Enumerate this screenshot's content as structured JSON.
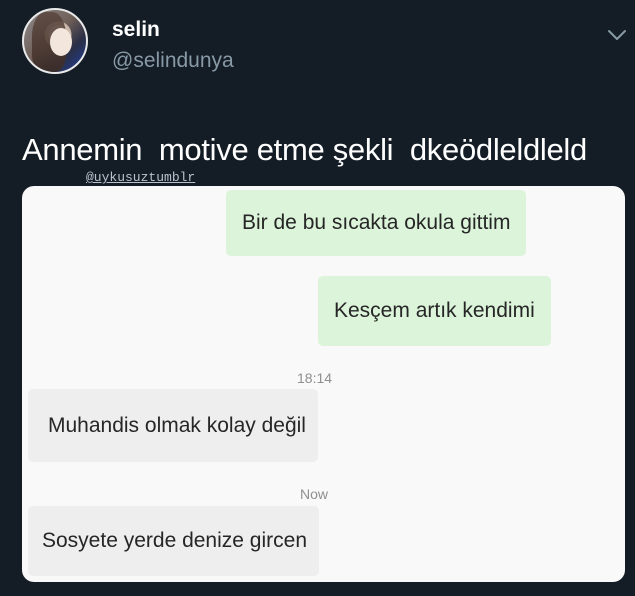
{
  "tweet": {
    "display_name": "selin",
    "handle": "@selindunya",
    "caption": "Annemin  motive etme şekli  dkeödleldleld",
    "watermark": "@uykusuztumblr",
    "menu_icon": "chevron-down-icon"
  },
  "chat": {
    "messages": [
      {
        "type": "sent",
        "text": "Bir de bu sıcakta okula gittim"
      },
      {
        "type": "sent",
        "text": "Kesçem artık kendimi"
      },
      {
        "type": "time",
        "text": "18:14"
      },
      {
        "type": "received",
        "text": "Muhandis olmak kolay değil"
      },
      {
        "type": "time",
        "text": "Now"
      },
      {
        "type": "received",
        "text": "Sosyete yerde denize gircen"
      }
    ]
  },
  "colors": {
    "background": "#141d26",
    "sent_bubble": "#dcf4da",
    "received_bubble": "#eeeeee",
    "handle_text": "#8899a6"
  }
}
